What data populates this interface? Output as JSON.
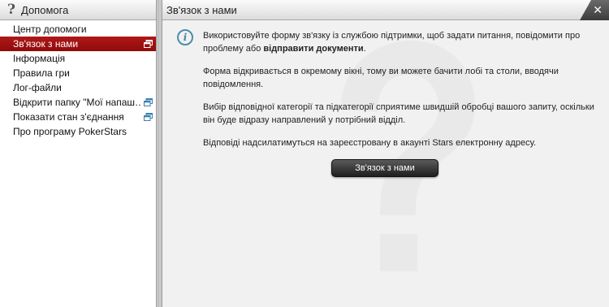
{
  "sidebar": {
    "title": "Допомога",
    "icon": "question-icon",
    "items": [
      {
        "label": "Центр допомоги",
        "active": false,
        "has_window_icon": false
      },
      {
        "label": "Зв'язок з нами",
        "active": true,
        "has_window_icon": true
      },
      {
        "label": "Інформація",
        "active": false,
        "has_window_icon": false
      },
      {
        "label": "Правила гри",
        "active": false,
        "has_window_icon": false
      },
      {
        "label": "Лог-файли",
        "active": false,
        "has_window_icon": false
      },
      {
        "label": "Відкрити папку \"Мої напаш…",
        "active": false,
        "has_window_icon": true
      },
      {
        "label": "Показати стан з'єднання",
        "active": false,
        "has_window_icon": true
      },
      {
        "label": "Про програму PokerStars",
        "active": false,
        "has_window_icon": false
      }
    ]
  },
  "main": {
    "title": "Зв'язок з нами",
    "close_label": "✕",
    "paragraph1_pre": "Використовуйте форму зв'язку із службою підтримки, щоб задати питання, повідомити про проблему або ",
    "paragraph1_bold": "відправити документи",
    "paragraph1_post": ".",
    "paragraph2": "Форма відкривається в окремому вікні, тому ви можете бачити лобі та столи, вводячи повідомлення.",
    "paragraph3": "Вибір відповідної категорії та підкатегорії сприятиме швидшій обробці вашого запиту, оскільки він буде відразу направлений у потрібний відділ.",
    "paragraph4": "Відповіді надсилатимуться на зареєстровану в акаунті Stars електронну адресу.",
    "button_label": "Зв'язок з нами"
  },
  "colors": {
    "active_item": "#9e1010",
    "info_icon": "#4b8fa7",
    "button": "#2a2a2a"
  }
}
